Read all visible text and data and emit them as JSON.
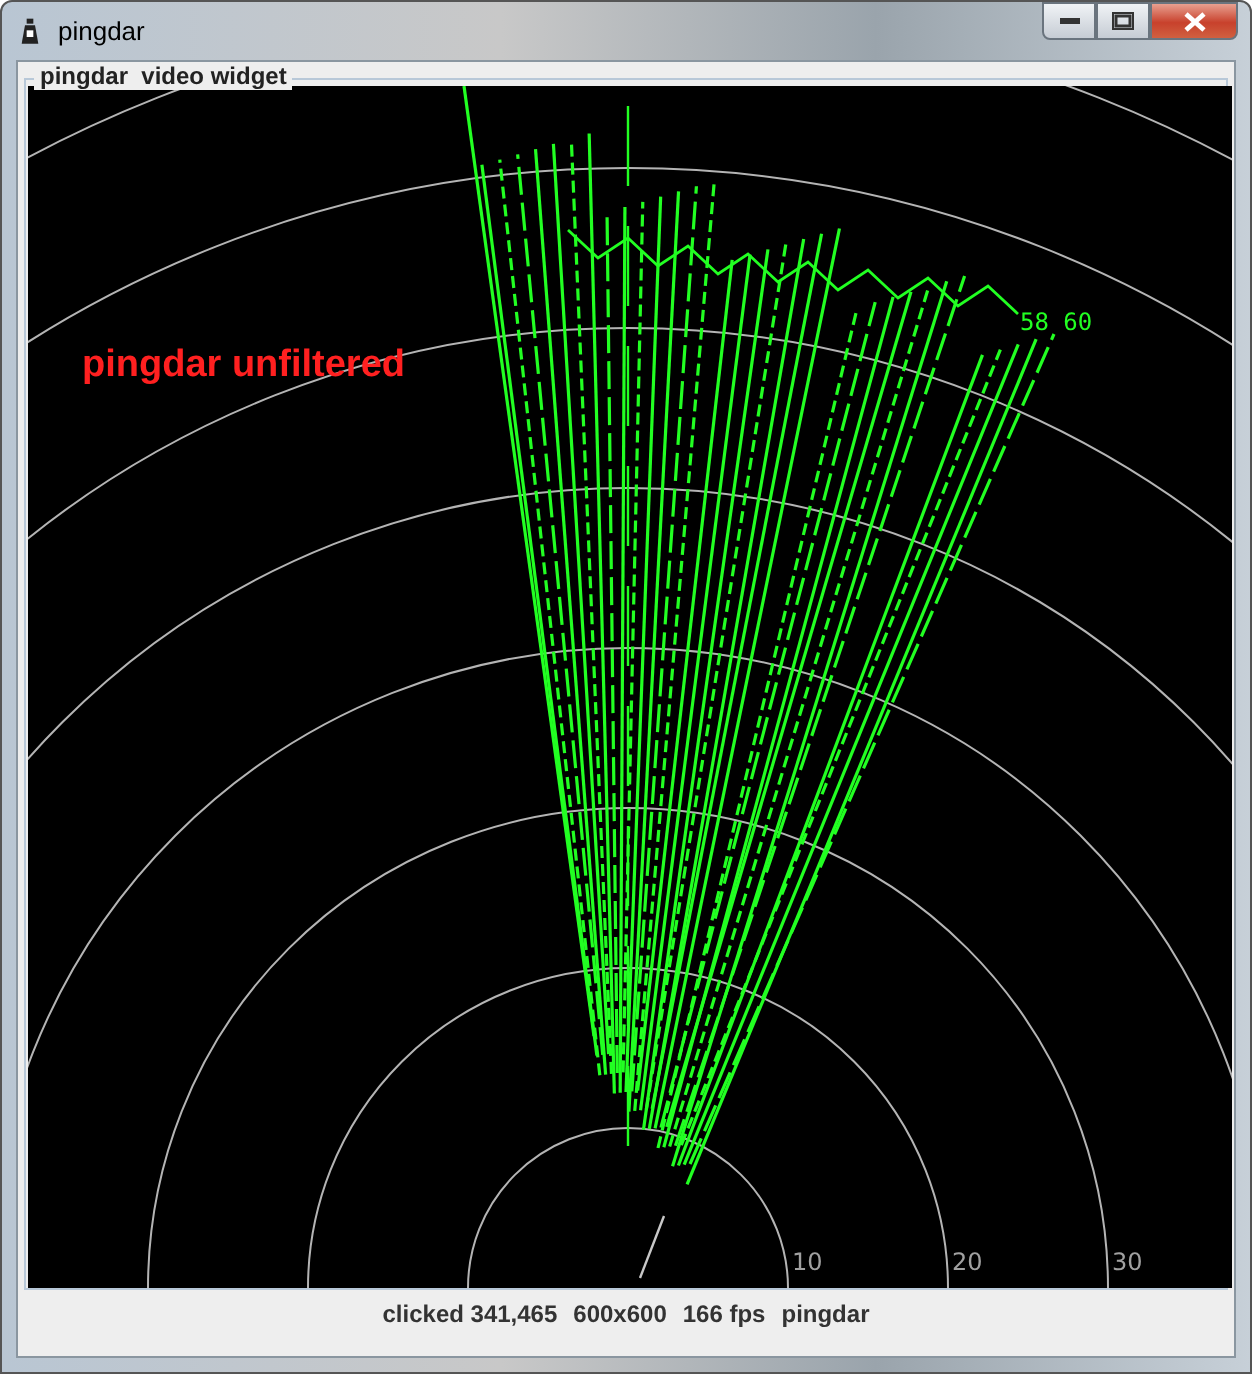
{
  "window": {
    "title": "pingdar"
  },
  "panel": {
    "title": "pingdar  video widget"
  },
  "radar": {
    "overlay_label": "pingdar unfiltered",
    "marker_label": "58 60",
    "range_labels": [
      "10",
      "20",
      "30"
    ]
  },
  "status_bar": {
    "items": [
      "clicked 341,465",
      "600x600",
      "166 fps",
      "pingdar"
    ]
  }
}
